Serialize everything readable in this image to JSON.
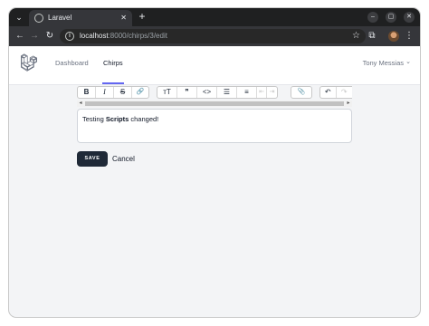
{
  "browser": {
    "tab_title": "Laravel",
    "tab_close": "✕",
    "new_tab": "+",
    "tab_menu": "⌄",
    "url_host": "localhost",
    "url_rest": ":8000/chirps/3/edit",
    "info_icon": "i",
    "back": "←",
    "forward": "→",
    "reload": "↻",
    "star": "☆",
    "extensions": "⧉",
    "menu": "⋮",
    "minimize": "–",
    "maximize": "▢",
    "close": "✕"
  },
  "nav": {
    "links": [
      {
        "label": "Dashboard",
        "active": false
      },
      {
        "label": "Chirps",
        "active": true
      }
    ],
    "user_name": "Tony Messias",
    "user_caret": "⌄"
  },
  "editor": {
    "toolbar": {
      "bold": "B",
      "italic": "I",
      "strike": "S",
      "link": "🔗",
      "heading": "тT",
      "quote": "❞",
      "code": "<>",
      "bullets": "☰",
      "numbers": "≡",
      "outdent": "⇤",
      "indent": "⇥",
      "attach": "📎",
      "undo": "↶",
      "redo": "↷"
    },
    "scroll_left": "◂",
    "scroll_right": "▸",
    "content_before": "Testing ",
    "content_bold": "Scripts",
    "content_after": " changed!"
  },
  "actions": {
    "save_label": "SAVE",
    "cancel_label": "Cancel"
  }
}
